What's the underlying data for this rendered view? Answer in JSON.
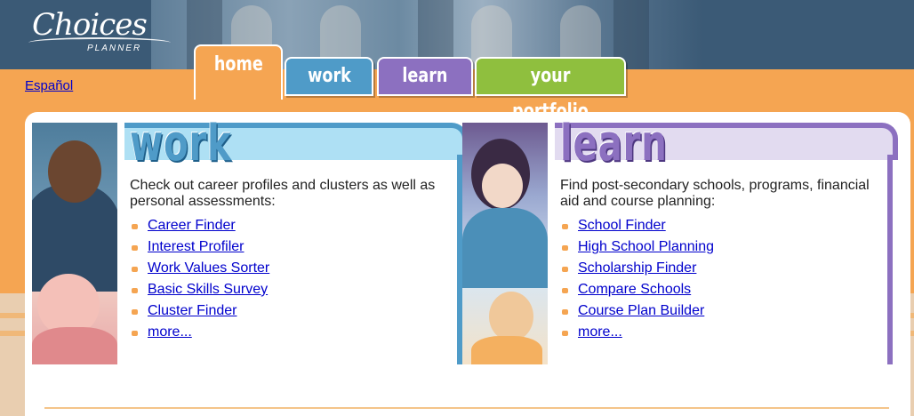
{
  "header": {
    "logo_text": "Choices",
    "logo_subtext": "PLANNER"
  },
  "language_link": "Español",
  "tabs": [
    {
      "label": "home"
    },
    {
      "label": "work"
    },
    {
      "label": "learn"
    },
    {
      "label": "your portfolio"
    }
  ],
  "colors": {
    "header_navy": "#3b5a76",
    "band_orange": "#f5a552",
    "work_blue": "#4f9bc8",
    "learn_purple": "#8c70c0",
    "portfolio_green": "#8fbf3e",
    "link_blue": "#0000cc"
  },
  "work": {
    "title": "work",
    "description": "Check out career profiles and clusters as well as personal assessments:",
    "links": [
      "Career Finder",
      "Interest Profiler",
      "Work Values Sorter",
      "Basic Skills Survey",
      "Cluster Finder",
      "more..."
    ]
  },
  "learn": {
    "title": "learn",
    "description": "Find post-secondary schools, programs, financial aid and course planning:",
    "links": [
      "School Finder",
      "High School Planning",
      "Scholarship Finder",
      "Compare Schools",
      "Course Plan Builder",
      "more..."
    ]
  }
}
